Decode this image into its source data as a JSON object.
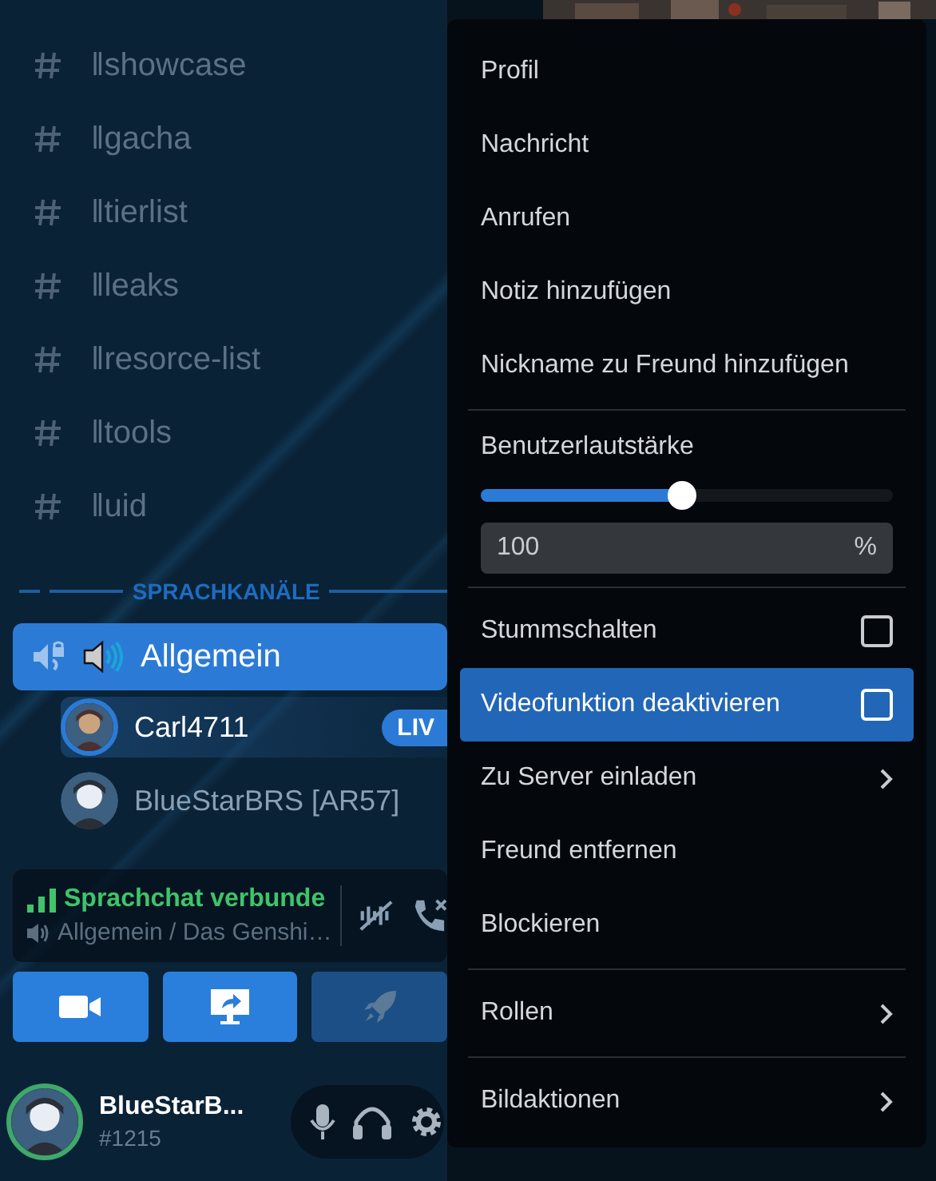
{
  "channels": [
    {
      "name": "‖showcase"
    },
    {
      "name": "‖gacha"
    },
    {
      "name": "‖tierlist"
    },
    {
      "name": "‖leaks"
    },
    {
      "name": "‖resorce-list"
    },
    {
      "name": "‖tools"
    },
    {
      "name": "‖uid"
    }
  ],
  "voice_section": {
    "title": "SPRACHKANÄLE"
  },
  "voice_channel": {
    "name": "Allgemein",
    "selected": true
  },
  "voice_users": [
    {
      "name": "Carl4711",
      "speaking": true,
      "badge": "LIV"
    },
    {
      "name": "BlueStarBRS [AR57]",
      "speaking": false
    }
  ],
  "connection": {
    "status": "Sprachchat verbunde",
    "channel": "Allgemein / Das Genshi…"
  },
  "call_buttons": [
    {
      "kind": "camera"
    },
    {
      "kind": "screen"
    },
    {
      "kind": "activity"
    }
  ],
  "user": {
    "name": "BlueStarB...",
    "tag": "#1215"
  },
  "menu": {
    "items": [
      {
        "kind": "item",
        "label": "Profil",
        "selected": false
      },
      {
        "kind": "item",
        "label": "Nachricht",
        "selected": false
      },
      {
        "kind": "item",
        "label": "Anrufen",
        "selected": false
      },
      {
        "kind": "item",
        "label": "Notiz hinzufügen",
        "selected": false
      },
      {
        "kind": "item",
        "label": "Nickname zu Freund hinzufügen",
        "selected": false
      },
      {
        "kind": "separator"
      },
      {
        "kind": "slider",
        "label": "Benutzerlautstärke",
        "level": 0.49
      },
      {
        "kind": "input",
        "value": "100",
        "unit": "%"
      },
      {
        "kind": "separator"
      },
      {
        "kind": "checkbox",
        "label": "Stummschalten",
        "checked": false,
        "selected": false
      },
      {
        "kind": "checkbox",
        "label": "Videofunktion deaktivieren",
        "checked": false,
        "selected": true
      },
      {
        "kind": "submenu",
        "label": "Zu Server einladen",
        "selected": false
      },
      {
        "kind": "item",
        "label": "Freund entfernen",
        "selected": false
      },
      {
        "kind": "item",
        "label": "Blockieren",
        "selected": false
      },
      {
        "kind": "separator"
      },
      {
        "kind": "submenu",
        "label": "Rollen",
        "selected": false
      },
      {
        "kind": "separator"
      },
      {
        "kind": "submenu",
        "label": "Bildaktionen",
        "selected": false
      }
    ]
  }
}
